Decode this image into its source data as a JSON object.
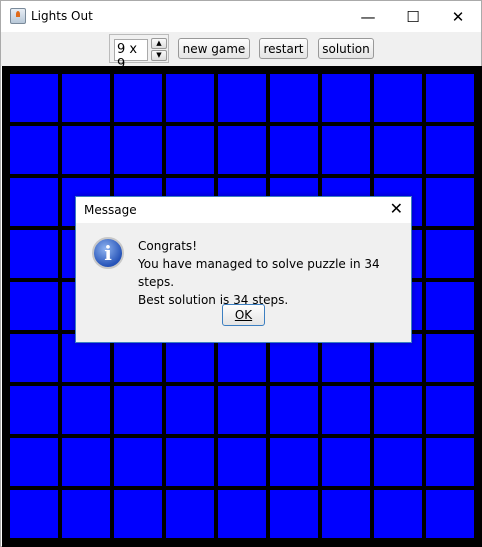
{
  "window": {
    "title": "Lights Out",
    "minimize": "—",
    "maximize": "☐",
    "close": "✕"
  },
  "toolbar": {
    "size_value": "9 x 9",
    "new_game": "new game",
    "restart": "restart",
    "solution": "solution"
  },
  "board": {
    "rows": 9,
    "cols": 9,
    "cell_color": "#0000ff",
    "background": "#000000"
  },
  "dialog": {
    "title": "Message",
    "close": "✕",
    "icon": "info-icon",
    "lines": [
      "Congrats!",
      "You have managed to solve puzzle in 34 steps.",
      "Best solution is 34 steps."
    ],
    "ok": "OK"
  }
}
